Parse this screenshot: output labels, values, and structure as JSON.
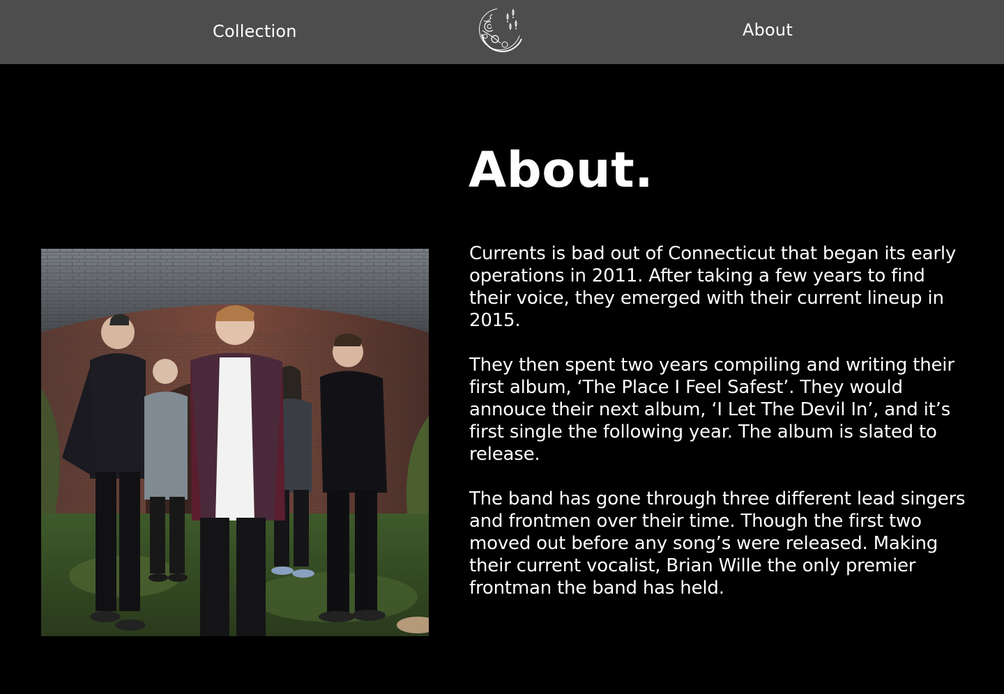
{
  "header": {
    "nav_left_label": "Collection",
    "nav_right_label": "About",
    "logo_icon": "crescent-moon-logo-icon",
    "background_color": "#4d4d4d"
  },
  "main": {
    "heading": "About.",
    "photo_icon": "band-photo",
    "paragraphs": [
      "Currents is bad out of Connecticut that began its early operations in 2011. After taking a few years to find their voice, they emerged with their current lineup in 2015.",
      "They then spent two years compiling and writing their first album, ‘The Place I Feel Safest’. They would annouce their next album, ‘I Let The Devil In’, and it’s first single the following year. The album is slated to release.",
      "The band has gone through three different lead singers and frontmen over their time. Though the first two moved out before any song’s were released. Making their current vocalist, Brian Wille the only premier frontman the band has held."
    ],
    "background_color": "#000000",
    "text_color": "#ffffff"
  }
}
